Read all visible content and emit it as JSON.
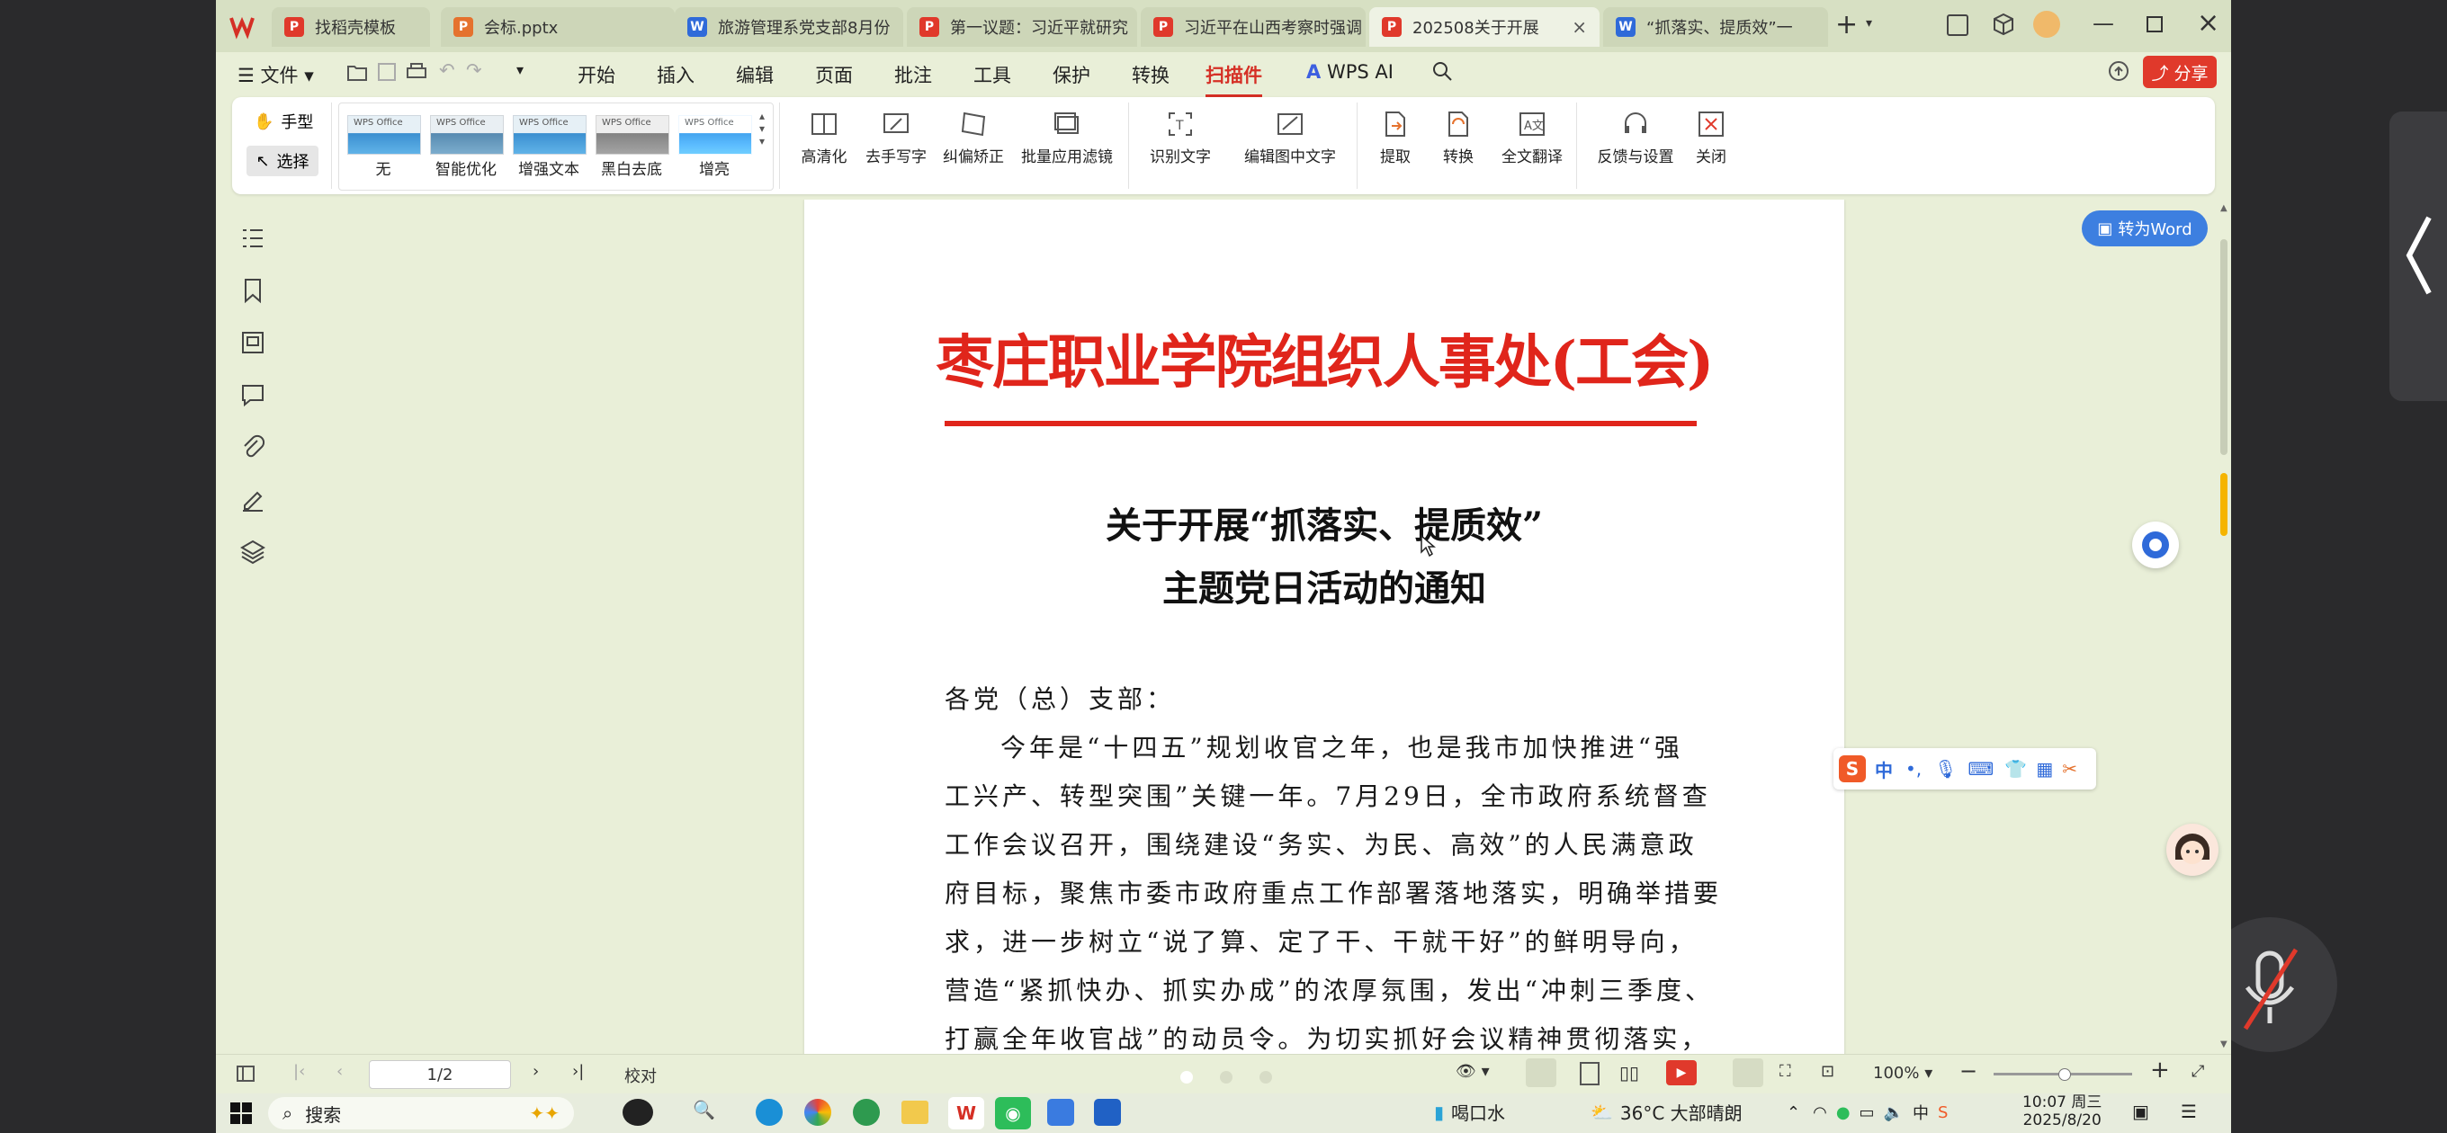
{
  "tabs": [
    {
      "label": "找稻壳模板",
      "icon_color": "#e0392b",
      "icon_text": "P"
    },
    {
      "label": "会标.pptx",
      "icon_color": "#e5722e",
      "icon_text": "P"
    },
    {
      "label": "旅游管理系党支部8月份",
      "icon_color": "#2f6ad9",
      "icon_text": "W"
    },
    {
      "label": "第一议题：习近平就研究",
      "icon_color": "#e0392b",
      "icon_text": "P"
    },
    {
      "label": "习近平在山西考察时强调",
      "icon_color": "#e0392b",
      "icon_text": "P"
    },
    {
      "label": "202508关于开展",
      "icon_color": "#e0392b",
      "icon_text": "P"
    },
    {
      "label": "“抓落实、提质效”一",
      "icon_color": "#2f6ad9",
      "icon_text": "W"
    }
  ],
  "menubar": {
    "file": "文件",
    "items": [
      "开始",
      "插入",
      "编辑",
      "页面",
      "批注",
      "工具",
      "保护",
      "转换",
      "扫描件"
    ],
    "wps_ai": "WPS AI",
    "share": "分享"
  },
  "ribbon": {
    "hand": "手型",
    "select": "选择",
    "thumb_caption": "WPS Office",
    "filters": [
      "无",
      "智能优化",
      "增强文本",
      "黑白去底",
      "增亮"
    ],
    "tools": [
      "高清化",
      "去手写字",
      "纠偏矫正",
      "批量应用滤镜",
      "识别文字",
      "编辑图中文字",
      "提取",
      "转换",
      "全文翻译",
      "反馈与设置",
      "关闭"
    ]
  },
  "document": {
    "header": "枣庄职业学院组织人事处(工会)",
    "title_line1": "关于开展“抓落实、提质效”",
    "title_line2": "主题党日活动的通知",
    "salutation": "各党（总）支部：",
    "body": [
      "今年是“十四五”规划收官之年，也是我市加快推进“强",
      "工兴产、转型突围”关键一年。7月29日，全市政府系统督查",
      "工作会议召开，围绕建设“务实、为民、高效”的人民满意政",
      "府目标，聚焦市委市政府重点工作部署落地落实，明确举措要",
      "求，进一步树立“说了算、定了干、干就干好”的鲜明导向，",
      "营造“紧抓快办、抓实办成”的浓厚氛围，发出“冲刺三季度、",
      "打赢全年收官战”的动员令。为切实抓好会议精神贯彻落实，"
    ]
  },
  "float": {
    "to_word": "转为Word",
    "ime_label": "中"
  },
  "statusbar": {
    "page": "1/2",
    "proofread": "校对",
    "zoom": "100%"
  },
  "taskbar": {
    "search": "搜索",
    "drink": "喝口水",
    "weather": "36°C 大部晴朗",
    "time": "10:07 周三",
    "date": "2025/8/20"
  },
  "colors": {
    "accent": "#d52f25",
    "header_red": "#e0251b",
    "word_blue": "#3d7fe0",
    "bg": "#e9efd8"
  }
}
